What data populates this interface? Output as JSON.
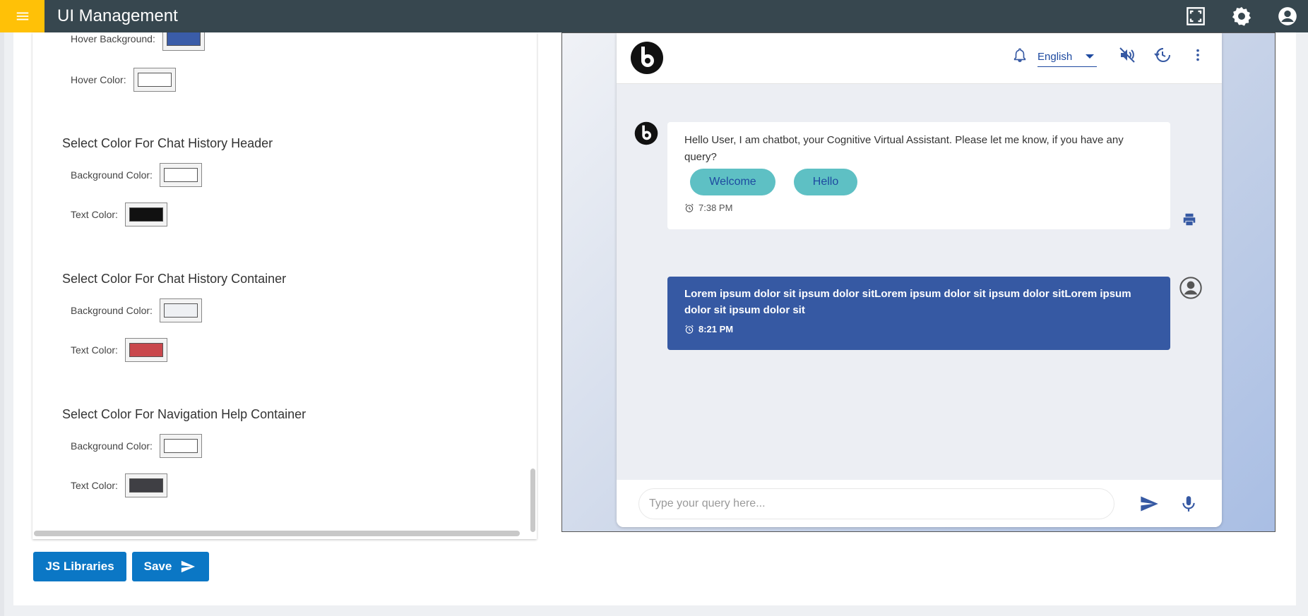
{
  "header": {
    "title": "UI Management",
    "icons": [
      "menu-icon",
      "fullscreen-icon",
      "settings-icon",
      "account-icon"
    ]
  },
  "settings": {
    "hover_background_label": "Hover Background:",
    "hover_color_label": "Hover Color:",
    "hover_background_value": "#3a5ca8",
    "hover_color_value": "#ffffff",
    "sections": [
      {
        "title": "Select Color For Chat History Header",
        "background_label": "Background Color:",
        "background_value": "#ffffff",
        "text_label": "Text Color:",
        "text_value": "#111111"
      },
      {
        "title": "Select Color For Chat History Container",
        "background_label": "Background Color:",
        "background_value": "#eef0f3",
        "text_label": "Text Color:",
        "text_value": "#c9474c"
      },
      {
        "title": "Select Color For Navigation Help Container",
        "background_label": "Background Color:",
        "background_value": "#ffffff",
        "text_label": "Text Color:",
        "text_value": "#3f3f44"
      }
    ]
  },
  "buttons": {
    "js_libraries": "JS Libraries",
    "save": "Save"
  },
  "preview": {
    "language": "English",
    "bot_message": "Hello User, I am chatbot, your Cognitive Virtual Assistant. Please let me know, if you have any query?",
    "chips": [
      "Welcome",
      "Hello"
    ],
    "bot_time": "7:38 PM",
    "user_message": "Lorem ipsum dolor sit ipsum dolor sitLorem ipsum dolor sit ipsum dolor sitLorem ipsum dolor sit ipsum dolor sit",
    "user_time": "8:21 PM",
    "input_placeholder": "Type your query here..."
  }
}
